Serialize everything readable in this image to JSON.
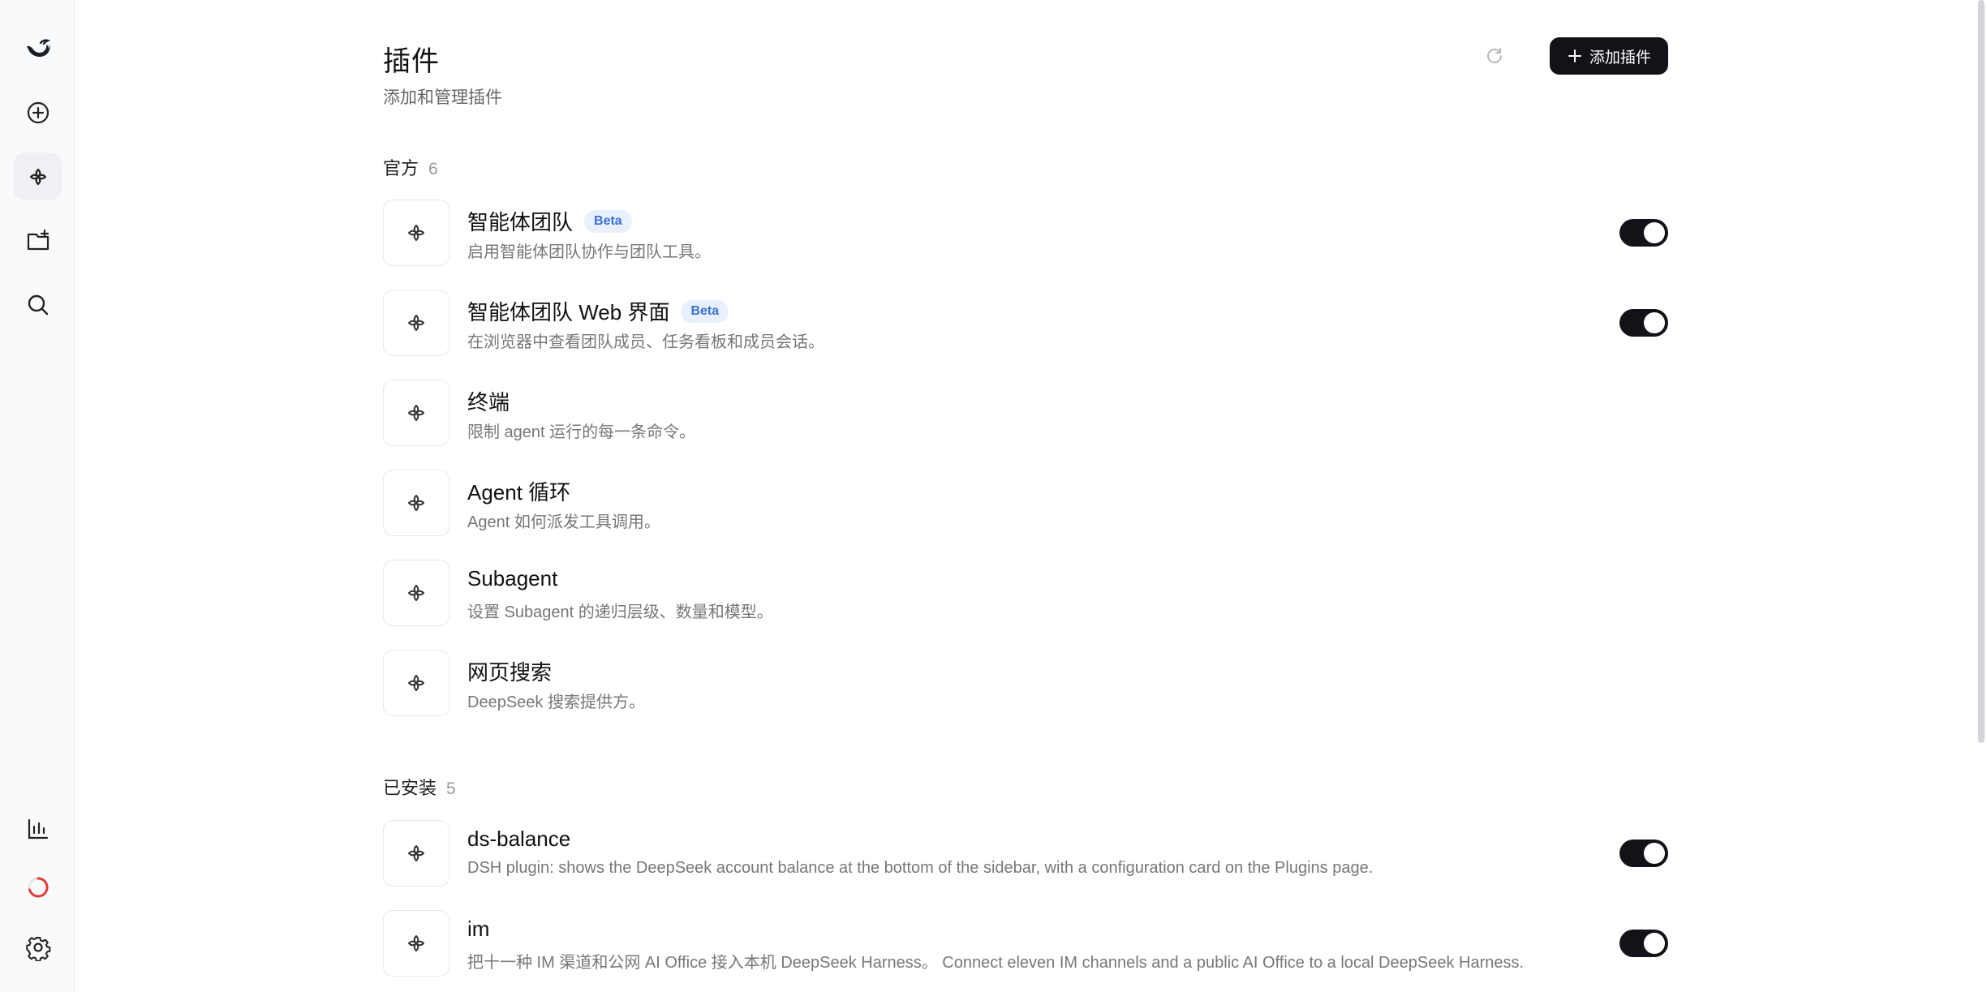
{
  "header": {
    "title": "插件",
    "subtitle": "添加和管理插件",
    "add_label": "添加插件"
  },
  "sections": {
    "official": {
      "label": "官方",
      "count": "6",
      "items": [
        {
          "name": "智能体团队",
          "badge": "Beta",
          "desc": "启用智能体团队协作与团队工具。",
          "enabled": true
        },
        {
          "name": "智能体团队 Web 界面",
          "badge": "Beta",
          "desc": "在浏览器中查看团队成员、任务看板和成员会话。",
          "enabled": true
        },
        {
          "name": "终端",
          "badge": "",
          "desc": "限制 agent 运行的每一条命令。",
          "enabled": null
        },
        {
          "name": "Agent 循环",
          "badge": "",
          "desc": "Agent 如何派发工具调用。",
          "enabled": null
        },
        {
          "name": "Subagent",
          "badge": "",
          "desc": "设置 Subagent 的递归层级、数量和模型。",
          "enabled": null
        },
        {
          "name": "网页搜索",
          "badge": "",
          "desc": "DeepSeek 搜索提供方。",
          "enabled": null
        }
      ]
    },
    "installed": {
      "label": "已安装",
      "count": "5",
      "items": [
        {
          "name": "ds-balance",
          "badge": "",
          "desc": "DSH plugin: shows the DeepSeek account balance at the bottom of the sidebar, with a configuration card on the Plugins page.",
          "enabled": true
        },
        {
          "name": "im",
          "badge": "",
          "desc": "把十一种 IM 渠道和公网 AI Office 接入本机 DeepSeek Harness。 Connect eleven IM channels and a public AI Office to a local DeepSeek Harness.",
          "enabled": true
        }
      ]
    }
  },
  "rail": {
    "items": [
      "logo-icon",
      "new-chat-icon",
      "plugins-icon",
      "new-project-icon",
      "search-icon",
      "stats-icon",
      "usage-ring-icon",
      "settings-icon"
    ]
  },
  "colors": {
    "accent": "#111318",
    "beta_bg": "#e8f0fe",
    "beta_text": "#3b6fd8",
    "usage_ring": "#e53935"
  }
}
